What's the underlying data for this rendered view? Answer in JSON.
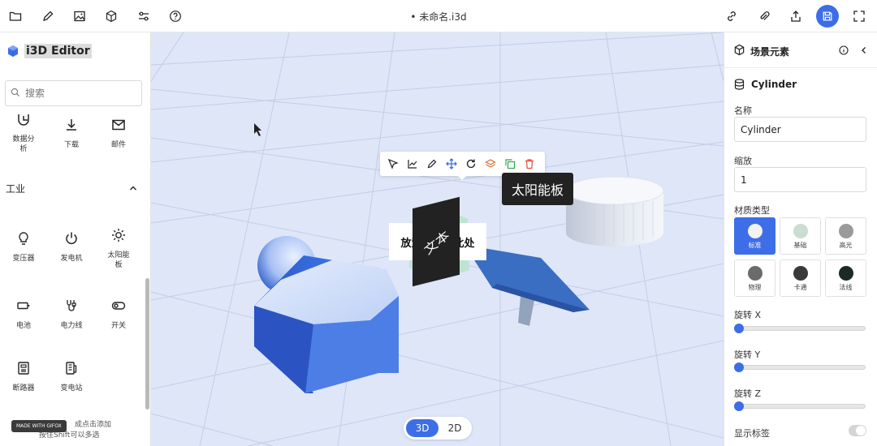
{
  "topbar": {
    "title": "• 未命名.i3d",
    "left_icons": [
      "folder-icon",
      "pencil-icon",
      "image-icon",
      "cube-icon",
      "sliders-icon",
      "help-icon"
    ],
    "right_icons": [
      "link-icon",
      "attachment-icon",
      "share-icon",
      "save-icon",
      "fullscreen-icon"
    ]
  },
  "sidebar": {
    "brand": "i3D Editor",
    "search_placeholder": "搜索",
    "items_top": [
      {
        "label": "数据分析",
        "icon": "data-analysis-icon"
      },
      {
        "label": "下载",
        "icon": "download-icon"
      },
      {
        "label": "邮件",
        "icon": "mail-icon"
      }
    ],
    "section_title": "工业",
    "items_industry": [
      {
        "label": "变压器",
        "icon": "transformer-icon"
      },
      {
        "label": "发电机",
        "icon": "generator-icon"
      },
      {
        "label": "太阳能板",
        "icon": "solar-panel-icon"
      },
      {
        "label": "电池",
        "icon": "battery-icon"
      },
      {
        "label": "电力线",
        "icon": "power-line-icon"
      },
      {
        "label": "开关",
        "icon": "switch-icon"
      },
      {
        "label": "断路器",
        "icon": "breaker-icon"
      },
      {
        "label": "变电站",
        "icon": "substation-icon"
      }
    ],
    "footer_badge": "MADE WITH GIFOX",
    "footer_hint_line1": "成点击添加",
    "footer_hint_line2": "按住Shift可以多选"
  },
  "canvas": {
    "tooltip": "太阳能板",
    "place_text": "放置文本到此处",
    "panel_text": "文本",
    "toolbar_tools": [
      "select-icon",
      "chart-icon",
      "pencil-icon",
      "move-icon",
      "rotate-icon",
      "layers-icon",
      "copy-icon",
      "delete-icon"
    ],
    "mode_3d": "3D",
    "mode_2d": "2D"
  },
  "right_panel": {
    "title": "场景元素",
    "object_name": "Cylinder",
    "name_label": "名称",
    "name_value": "Cylinder",
    "scale_label": "缩放",
    "scale_value": "1",
    "material_label": "材质类型",
    "materials": [
      {
        "label": "标准",
        "color": "#f2f2f2",
        "selected": true
      },
      {
        "label": "基础",
        "color": "#c9ddd2",
        "selected": false
      },
      {
        "label": "高光",
        "color": "#9a9a9a",
        "selected": false
      },
      {
        "label": "物理",
        "color": "#6b6b6b",
        "selected": false
      },
      {
        "label": "卡通",
        "color": "#3a3a3c",
        "selected": false
      },
      {
        "label": "法线",
        "color": "#1c2a24",
        "selected": false
      }
    ],
    "rotate_x_label": "旋转 X",
    "rotate_y_label": "旋转 Y",
    "rotate_z_label": "旋转 Z",
    "rotate_x": 0,
    "rotate_y": 0,
    "rotate_z": 0,
    "show_label": "显示标签",
    "show_label_on": false
  },
  "colors": {
    "accent": "#3d6ee8",
    "canvas_bg": "#dfe6f8",
    "hexagon": "#2f5dc9",
    "panel_blue": "#3a6ec2"
  }
}
